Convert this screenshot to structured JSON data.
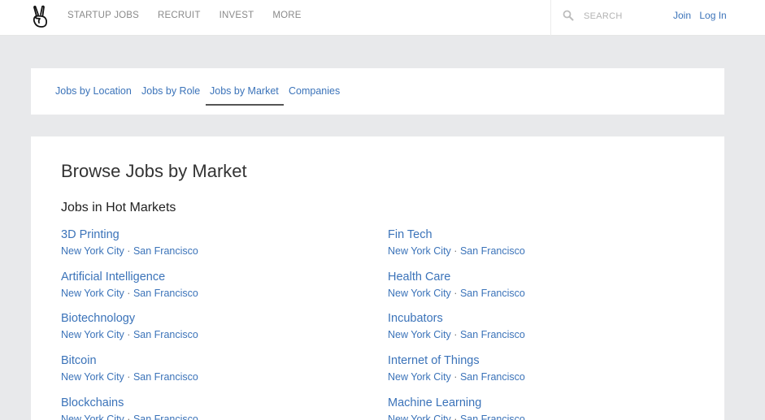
{
  "header": {
    "nav": [
      "STARTUP JOBS",
      "RECRUIT",
      "INVEST",
      "MORE"
    ],
    "search_placeholder": "SEARCH",
    "join_label": "Join",
    "login_label": "Log In"
  },
  "tabs": [
    {
      "label": "Jobs by Location"
    },
    {
      "label": "Jobs by Role"
    },
    {
      "label": "Jobs by Market",
      "active": true
    },
    {
      "label": "Companies"
    }
  ],
  "main": {
    "title": "Browse Jobs by Market",
    "section_title": "Jobs in Hot Markets",
    "city_a": "New York City",
    "city_separator": "·",
    "city_b": "San Francisco",
    "left_markets": [
      "3D Printing",
      "Artificial Intelligence",
      "Biotechnology",
      "Bitcoin",
      "Blockchains"
    ],
    "right_markets": [
      "Fin Tech",
      "Health Care",
      "Incubators",
      "Internet of Things",
      "Machine Learning"
    ]
  },
  "colors": {
    "link": "#3b73b9",
    "nav": "#8a8a8a",
    "background": "#e8e9eb"
  }
}
